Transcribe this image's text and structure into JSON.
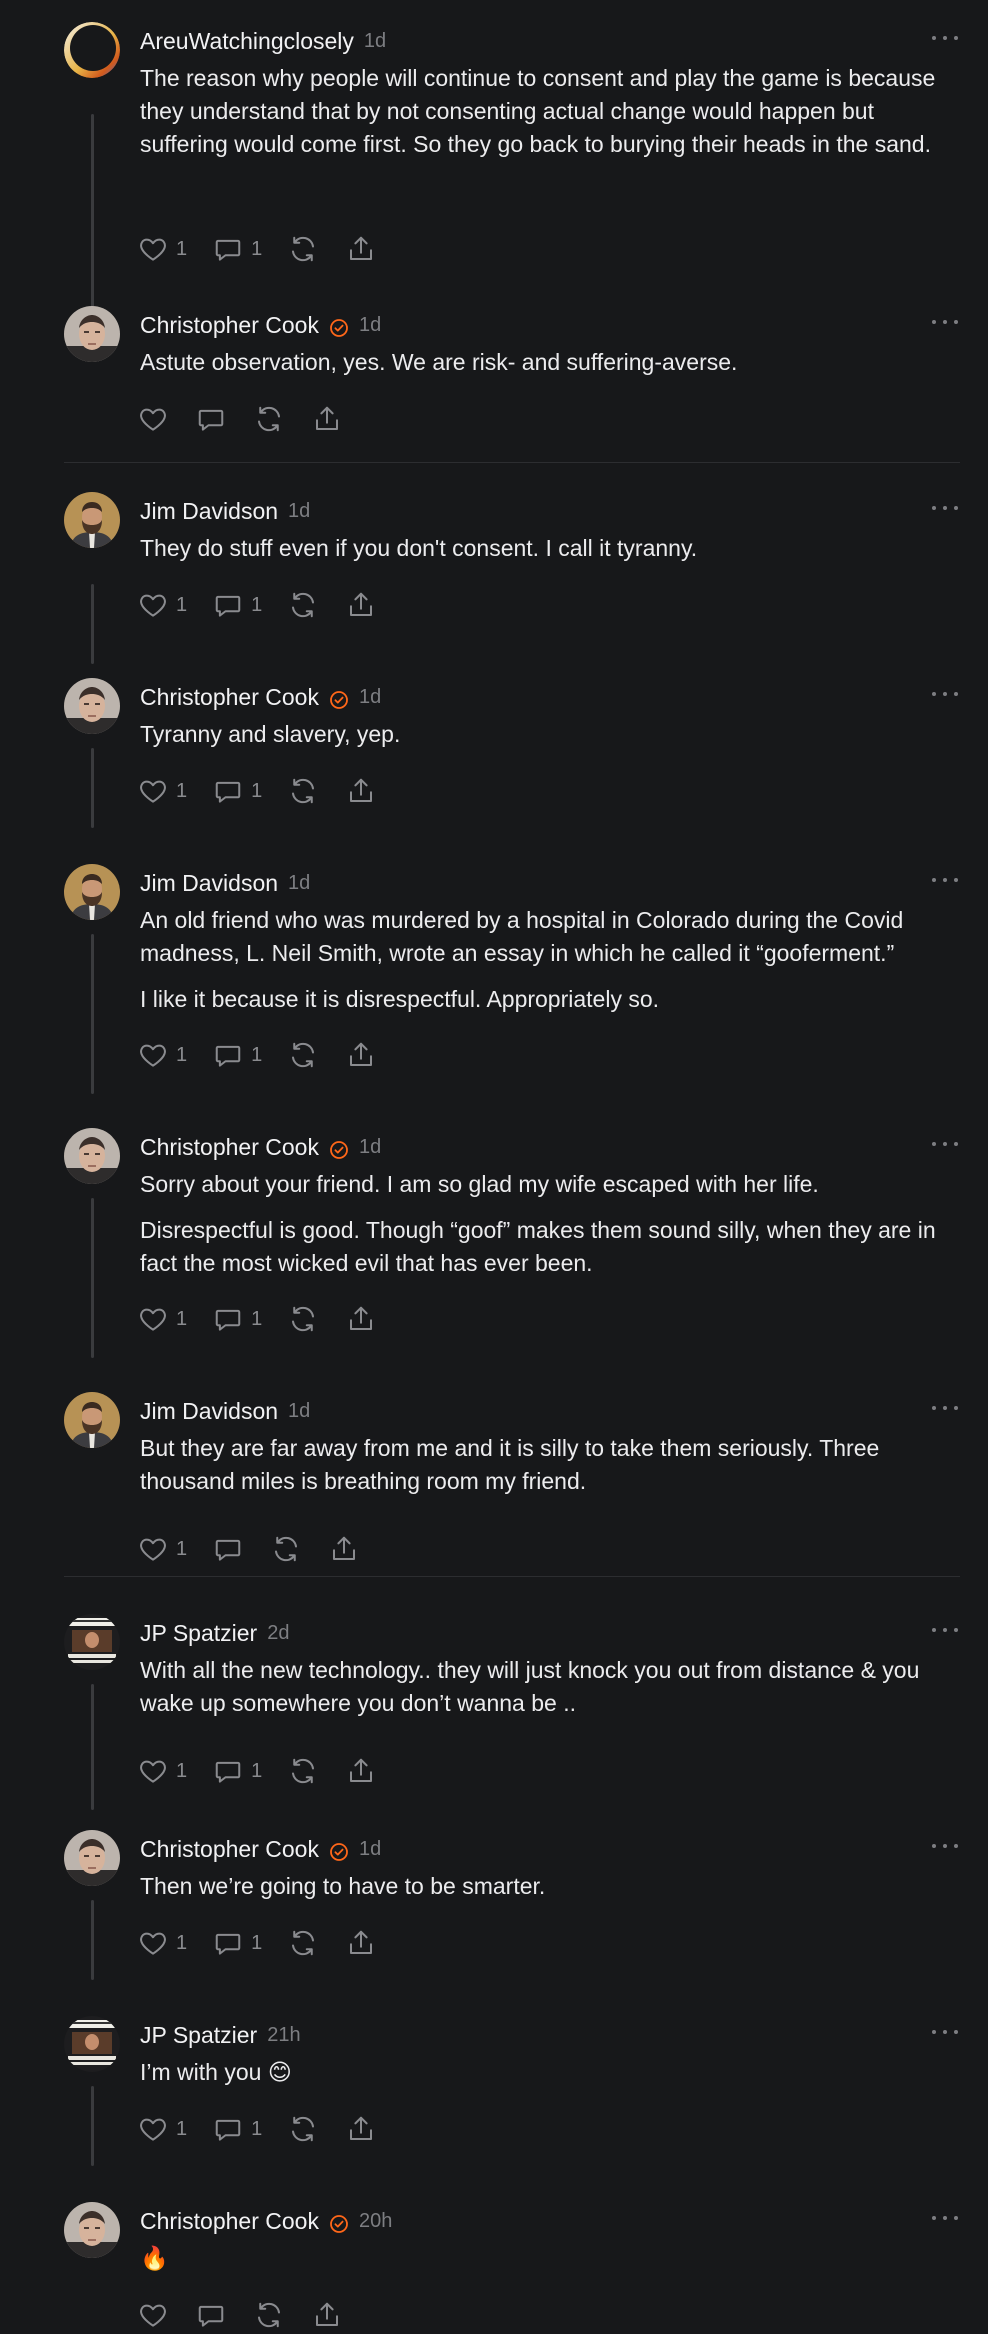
{
  "comments": [
    {
      "author": "AreuWatchingclosely",
      "time": "1d",
      "verified": false,
      "avatar": "avatar-ring",
      "paragraphs": [
        "The reason why people will continue to consent and play the game is because they understand that by not consenting actual change would happen but suffering would come first. So they go back to burying their heads in the sand."
      ],
      "likes": "1",
      "replies": "1"
    },
    {
      "author": "Christopher Cook",
      "time": "1d",
      "verified": true,
      "avatar": "avatar-cc",
      "paragraphs": [
        "Astute observation, yes. We are risk- and suffering-averse."
      ],
      "likes": "",
      "replies": ""
    },
    {
      "author": "Jim Davidson",
      "time": "1d",
      "verified": false,
      "avatar": "avatar-jd",
      "paragraphs": [
        "They do stuff even if you don't consent. I call it tyranny."
      ],
      "likes": "1",
      "replies": "1"
    },
    {
      "author": "Christopher Cook",
      "time": "1d",
      "verified": true,
      "avatar": "avatar-cc",
      "paragraphs": [
        "Tyranny and slavery, yep."
      ],
      "likes": "1",
      "replies": "1"
    },
    {
      "author": "Jim Davidson",
      "time": "1d",
      "verified": false,
      "avatar": "avatar-jd",
      "paragraphs": [
        "An old friend who was murdered by a hospital in Colorado during the Covid madness, L. Neil Smith, wrote an essay in which he called it “gooferment.”",
        "I like it because it is disrespectful. Appropriately so."
      ],
      "likes": "1",
      "replies": "1"
    },
    {
      "author": "Christopher Cook",
      "time": "1d",
      "verified": true,
      "avatar": "avatar-cc",
      "paragraphs": [
        "Sorry about your friend. I am so glad my wife escaped with her life.",
        "Disrespectful is good. Though “goof” makes them sound silly, when they are in fact the most wicked evil that has ever been."
      ],
      "likes": "1",
      "replies": "1"
    },
    {
      "author": "Jim Davidson",
      "time": "1d",
      "verified": false,
      "avatar": "avatar-jd",
      "paragraphs": [
        "But they are far away from me and it is silly to take them seriously. Three thousand miles is breathing room my friend."
      ],
      "likes": "1",
      "replies": ""
    },
    {
      "author": "JP Spatzier",
      "time": "2d",
      "verified": false,
      "avatar": "avatar-jp",
      "paragraphs": [
        "With all the new technology.. they will just knock you out from distance & you wake up somewhere you don’t wanna be .."
      ],
      "likes": "1",
      "replies": "1"
    },
    {
      "author": "Christopher Cook",
      "time": "1d",
      "verified": true,
      "avatar": "avatar-cc",
      "paragraphs": [
        "Then we’re going to have to be smarter."
      ],
      "likes": "1",
      "replies": "1"
    },
    {
      "author": "JP Spatzier",
      "time": "21h",
      "verified": false,
      "avatar": "avatar-jp",
      "paragraphs": [
        "I’m with you 😊"
      ],
      "likes": "1",
      "replies": "1"
    },
    {
      "author": "Christopher Cook",
      "time": "20h",
      "verified": true,
      "avatar": "avatar-cc",
      "paragraphs": [
        "🔥"
      ],
      "likes": "",
      "replies": ""
    }
  ],
  "colors": {
    "background": "#17181a",
    "verified": "#ff6719",
    "muted": "#7d7e82",
    "text": "#ececee"
  },
  "icons": [
    "heart-icon",
    "comment-icon",
    "restack-icon",
    "share-icon",
    "more-icon",
    "verified-icon"
  ]
}
